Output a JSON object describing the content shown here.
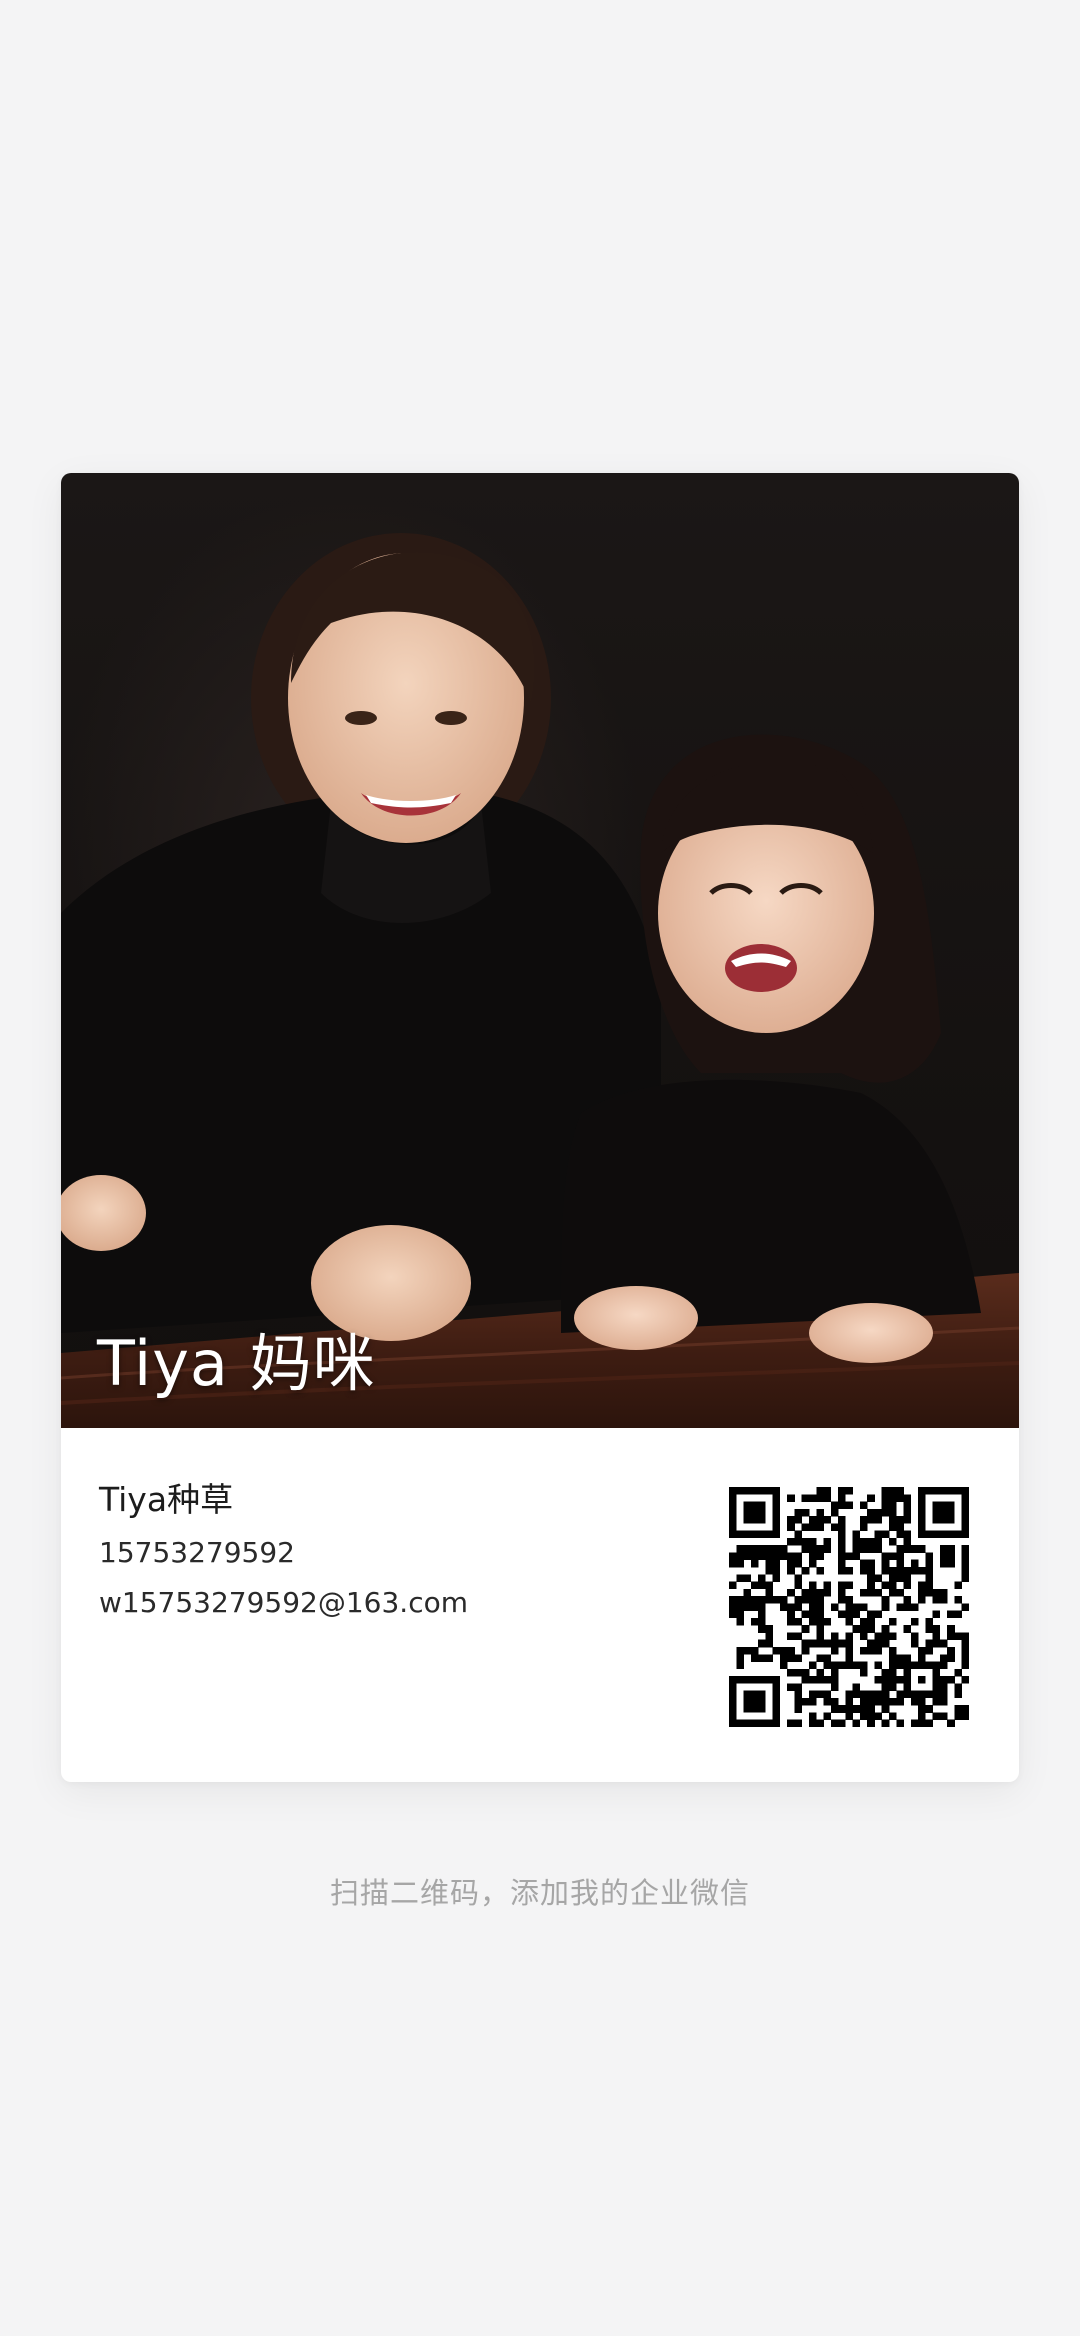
{
  "card": {
    "photo_name": "Tiya 妈咪",
    "name": "Tiya种草",
    "phone": "15753279592",
    "email": "w15753279592@163.com",
    "qr_icon": "qr-code-icon"
  },
  "hint": "扫描二维码，添加我的企业微信",
  "colors": {
    "background": "#f4f4f5",
    "card": "#ffffff",
    "hint_text": "#a6a6a6",
    "primary_text": "#1c1c1c"
  }
}
